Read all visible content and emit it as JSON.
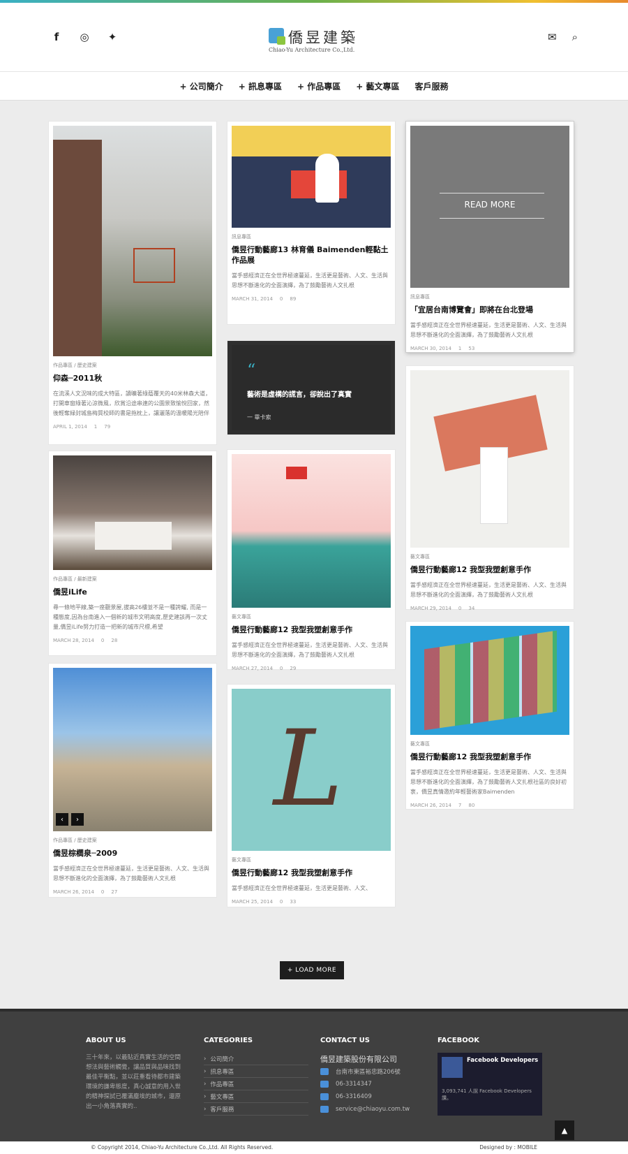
{
  "header": {
    "brand_name": "僑昱建築",
    "brand_sub": "Chiao-Yu Architecture Co.,Ltd.",
    "social": [
      {
        "icon": "facebook-icon",
        "glyph": "f"
      },
      {
        "icon": "dribbble-icon",
        "glyph": "◎"
      },
      {
        "icon": "twitter-icon",
        "glyph": "✦"
      }
    ],
    "mail_glyph": "✉",
    "search_glyph": "⌕"
  },
  "nav": {
    "items": [
      "+ 公司簡介",
      "+ 訊息專區",
      "+ 作品專區",
      "+ 藝文專區",
      "客戶服務"
    ]
  },
  "cards": [
    {
      "cat": "作品專區 / 歷史建案",
      "title": "仰森─2011秋",
      "excerpt": "在流溪人文況味的成大特區，讀曠著綠蔭覆天的40米林森大道，打開車窗綠著沁涼微風，欣賞沿途串連的公園景致愉悅回家，然後輕奪緑封城島梅質校師的書是拖枕上，讓灑落的溫暖陽光陪伴您，來上一杯咖啡和一曲樂章,在家的",
      "date": "APRIL 1, 2014",
      "comments": "1",
      "likes": "79"
    },
    {
      "cat": "作品專區 / 最新建案",
      "title": "僑昱iLife",
      "excerpt": "尋一條地平線,築一座觀景屋,拔高26樓並不是一種誇耀, 而是一種態度,因為台南進入一個新的城市文明高度,歷史建該再一次丈量,僑昱iLife努力打造一把新的城市尺標,希望",
      "date": "MARCH 28, 2014",
      "comments": "0",
      "likes": "28"
    },
    {
      "cat": "作品專區 / 歷史建案",
      "title": "僑昱棕櫚泉─2009",
      "excerpt": "當手感經濟正在全世界極速蔓延，生活更是藝術、人文、生活與思想不斷進化的全面演繹，為了鼓勵藝術人文扎根",
      "date": "MARCH 26, 2014",
      "comments": "0",
      "likes": "27"
    },
    {
      "cat": "訊息專區",
      "title": "僑昱行動藝廊13 林育儀 Baimenden輕黏土作品展",
      "excerpt": "當手感經濟正在全世界極速蔓延，生活更是藝術、人文、生活與思想不斷進化的全面演繹，為了鼓勵藝術人文扎根",
      "date": "MARCH 31, 2014",
      "comments": "0",
      "likes": "89"
    },
    {
      "quote": "藝術是虛構的謊言，卻說出了真實",
      "author": "一 畢卡索"
    },
    {
      "cat": "藝文專區",
      "title": "僑昱行動藝廊12 我型我塑創意手作",
      "excerpt": "當手感經濟正在全世界極速蔓延，生活更是藝術、人文、生活與思想不斷進化的全面演繹，為了鼓勵藝術人文扎根",
      "date": "MARCH 27, 2014",
      "comments": "0",
      "likes": "29"
    },
    {
      "cat": "藝文專區",
      "title": "僑昱行動藝廊12 我型我塑創意手作",
      "excerpt": "當手感經濟正在全世界極速蔓延，生活更是藝術、人文、",
      "date": "MARCH 25, 2014",
      "comments": "0",
      "likes": "33"
    },
    {
      "cat": "訊息專區",
      "title": "「宜居台南博覽會」即將在台北登場",
      "excerpt": "當手感經濟正在全世界極速蔓延，生活更是藝術、人文、生活與思想不斷進化的全面演繹，為了鼓勵藝術人文扎根",
      "date": "MARCH 30, 2014",
      "comments": "1",
      "likes": "53",
      "overlay": "READ MORE"
    },
    {
      "cat": "藝文專區",
      "title": "僑昱行動藝廊12 我型我塑創意手作",
      "excerpt": "當手感經濟正在全世界極速蔓延，生活更是藝術、人文、生活與思想不斷進化的全面演繹，為了鼓勵藝術人文扎根",
      "date": "MARCH 29, 2014",
      "comments": "0",
      "likes": "34"
    },
    {
      "cat": "藝文專區",
      "title": "僑昱行動藝廊12 我型我塑創意手作",
      "excerpt": "當手感經濟正在全世界極速蔓延，生活更是藝術、人文、生活與思想不斷進化的全面演繹，為了鼓勵藝術人文扎根社區的良好初衷，僑昱真情邀約年輕藝術家Baimenden",
      "date": "MARCH 26, 2014",
      "comments": "7",
      "likes": "80"
    }
  ],
  "load_more": "+ LOAD MORE",
  "footer": {
    "about_title": "ABOUT US",
    "about_text": "三十年來，以最貼近真實生活的空間想法與藝術觸覺，讓品質與品味找到最佳平衡點，並以莊重看待都市建築環境的謙卑態度，真心誠意的用入世的精神探試已覆滿塵埃的城市，還原出一小角落真實的..",
    "categories_title": "CATEGORIES",
    "categories": [
      "公司簡介",
      "訊息專區",
      "作品專區",
      "藝文專區",
      "客戶服務"
    ],
    "contact_title": "CONTACT US",
    "company": "僑昱建築股份有限公司",
    "address": "台南市東區裕忠路206號",
    "phone": "06-3314347",
    "fax": "06-3316409",
    "email": "service@chiaoyu.com.tw",
    "facebook_title": "FACEBOOK",
    "fb_page": "Facebook Developers",
    "fb_likes": "3,093,741 人說 Facebook Developers 讚。"
  },
  "copyright": "© Copyright 2014, Chiao-Yu Architecture Co.,Ltd.  All Rights Reserved.",
  "designed_by": "Designed by : MOBILE"
}
